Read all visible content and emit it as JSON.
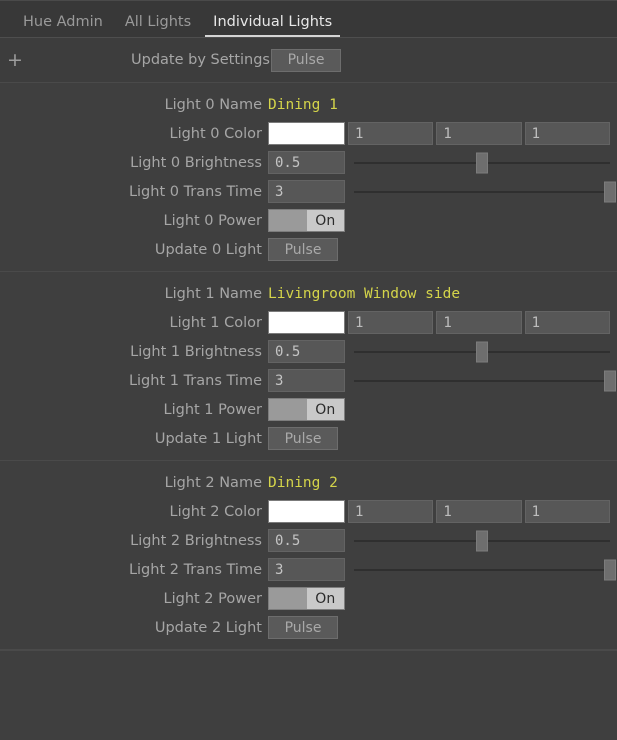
{
  "tabs": [
    {
      "label": "Hue Admin",
      "active": false
    },
    {
      "label": "All Lights",
      "active": false
    },
    {
      "label": "Individual Lights",
      "active": true
    }
  ],
  "toolbar": {
    "add_icon": "plus-icon",
    "update_by_settings_label": "Update by Settings",
    "pulse_label": "Pulse"
  },
  "lights": [
    {
      "name_label": "Light 0 Name",
      "name_value": "Dining 1",
      "color_label": "Light 0 Color",
      "color_swatch": "#ffffff",
      "color_channels": [
        "1",
        "1",
        "1"
      ],
      "brightness_label": "Light 0 Brightness",
      "brightness_value": "0.5",
      "brightness_pct": 50,
      "trans_label": "Light 0 Trans Time",
      "trans_value": "3",
      "trans_pct": 100,
      "power_label": "Light 0 Power",
      "power_state": "On",
      "update_label": "Update 0 Light",
      "update_button": "Pulse"
    },
    {
      "name_label": "Light 1 Name",
      "name_value": "Livingroom Window side",
      "color_label": "Light 1 Color",
      "color_swatch": "#ffffff",
      "color_channels": [
        "1",
        "1",
        "1"
      ],
      "brightness_label": "Light 1 Brightness",
      "brightness_value": "0.5",
      "brightness_pct": 50,
      "trans_label": "Light 1 Trans Time",
      "trans_value": "3",
      "trans_pct": 100,
      "power_label": "Light 1 Power",
      "power_state": "On",
      "update_label": "Update 1 Light",
      "update_button": "Pulse"
    },
    {
      "name_label": "Light 2 Name",
      "name_value": "Dining 2",
      "color_label": "Light 2 Color",
      "color_swatch": "#ffffff",
      "color_channels": [
        "1",
        "1",
        "1"
      ],
      "brightness_label": "Light 2 Brightness",
      "brightness_value": "0.5",
      "brightness_pct": 50,
      "trans_label": "Light 2 Trans Time",
      "trans_value": "3",
      "trans_pct": 100,
      "power_label": "Light 2 Power",
      "power_state": "On",
      "update_label": "Update 2 Light",
      "update_button": "Pulse"
    }
  ],
  "colors": {
    "background": "#3f3f3f",
    "panel": "#383838",
    "name_accent": "#d4d44a",
    "label_text": "#a6a6a6",
    "field_bg": "#575757",
    "toggle_on_bg": "#c9c9c9"
  }
}
